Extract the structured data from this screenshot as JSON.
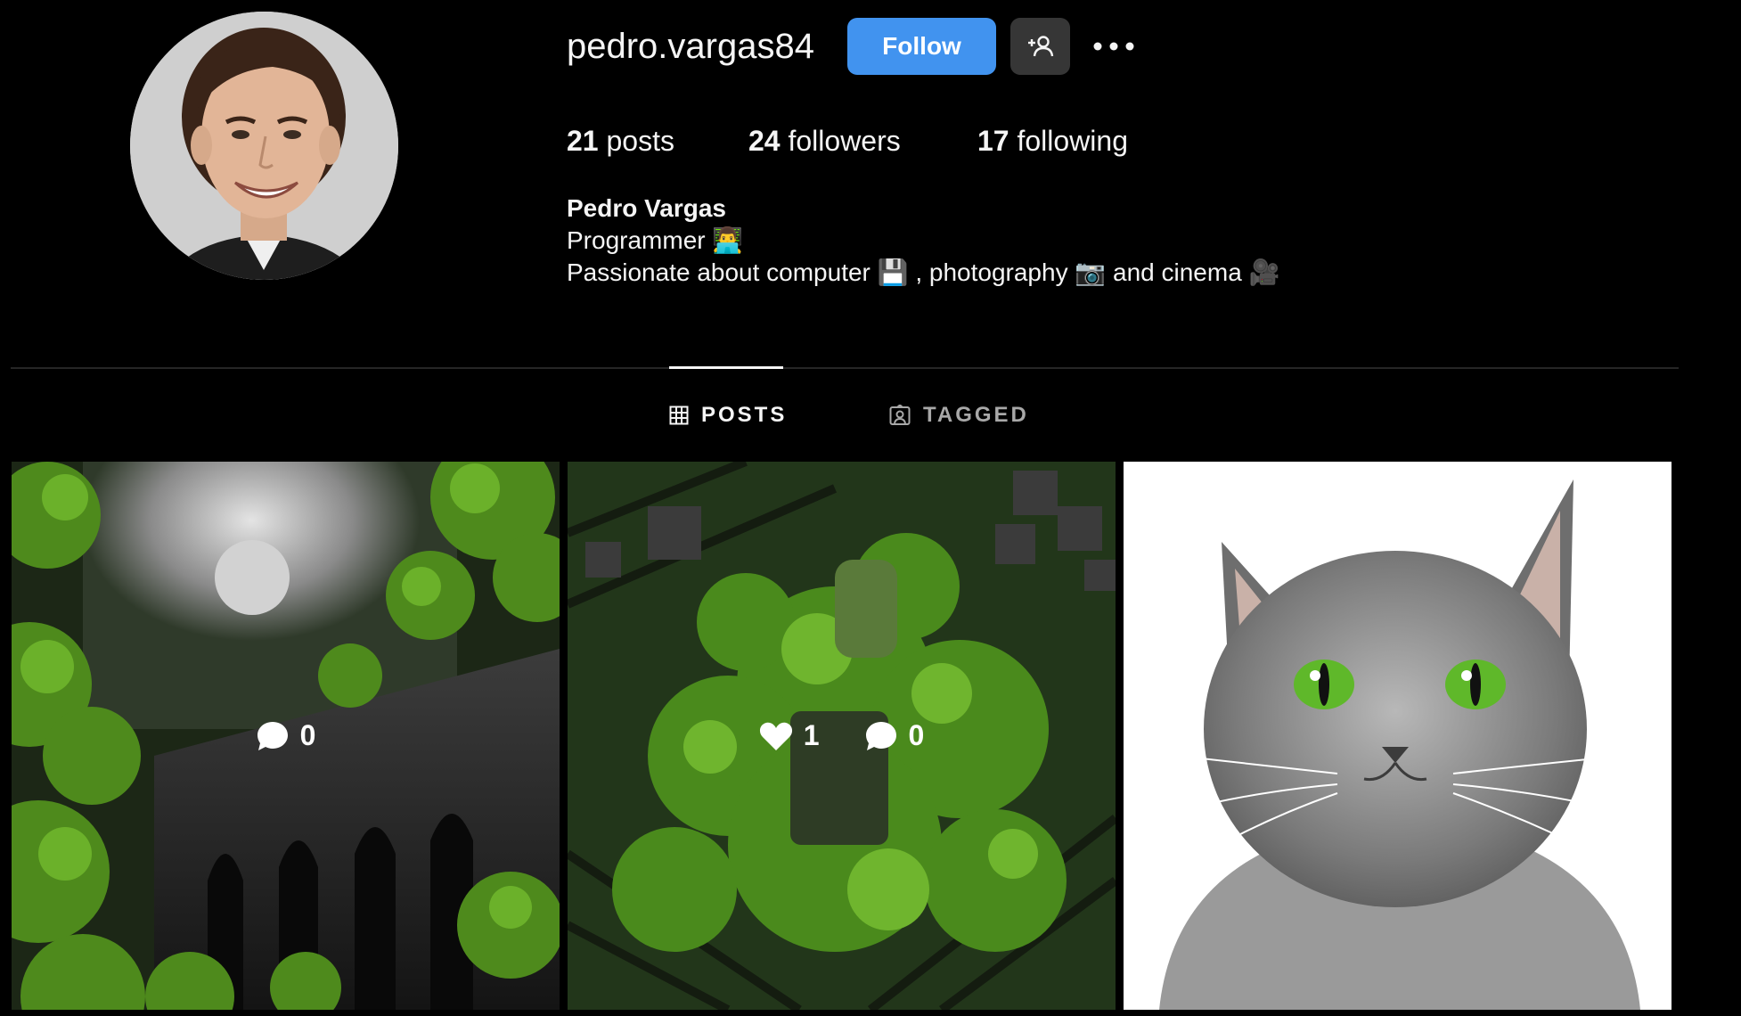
{
  "profile": {
    "username": "pedro.vargas84",
    "follow_label": "Follow",
    "stats": {
      "posts_count": "21",
      "posts_label": "posts",
      "followers_count": "24",
      "followers_label": "followers",
      "following_count": "17",
      "following_label": "following"
    },
    "bio": {
      "name": "Pedro Vargas",
      "line1": "Programmer",
      "line1_emoji": "👨‍💻",
      "line2_part1": "Passionate about computer",
      "emoji_floppy": "💾",
      "line2_part2": ", photography",
      "emoji_camera": "📷",
      "line2_part3": "and cinema",
      "emoji_movie_camera": "🎥"
    }
  },
  "tabs": [
    {
      "label": "POSTS",
      "icon": "grid-icon",
      "active": true
    },
    {
      "label": "TAGGED",
      "icon": "tagged-person-icon",
      "active": false
    }
  ],
  "posts": [
    {
      "description_icon": "mossy-ruins-image",
      "comments": "0"
    },
    {
      "description_icon": "mossy-circuit-image",
      "likes": "1",
      "comments": "0"
    },
    {
      "description_icon": "grey-cat-drawing-image"
    }
  ],
  "colors": {
    "background": "#000000",
    "follow_button": "#4193ef",
    "secondary_button": "#363636",
    "divider": "#262626",
    "muted_text": "#a8a8a8"
  }
}
